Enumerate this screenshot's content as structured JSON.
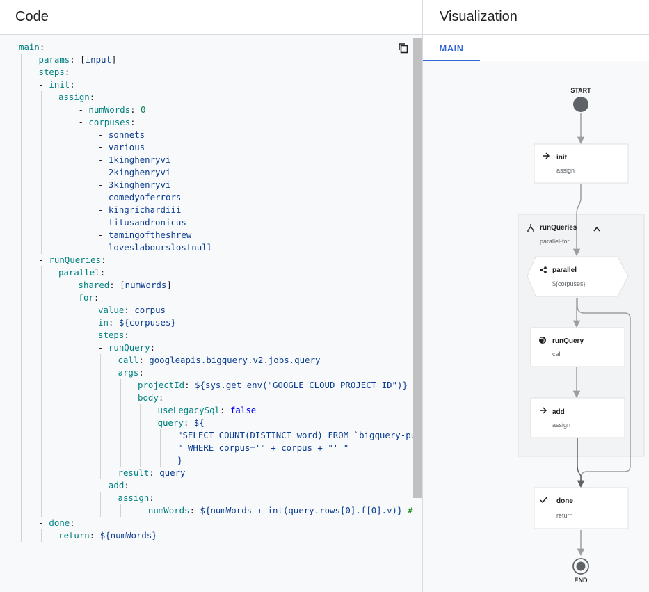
{
  "code_panel": {
    "title": "Code",
    "copy_icon": "copy-icon",
    "lines": [
      {
        "indent": 0,
        "tokens": [
          [
            "key",
            "main"
          ],
          [
            "punc",
            ":"
          ]
        ]
      },
      {
        "indent": 1,
        "tokens": [
          [
            "key",
            "params"
          ],
          [
            "punc",
            ": ["
          ],
          [
            "val",
            "input"
          ],
          [
            "punc",
            "]"
          ]
        ]
      },
      {
        "indent": 1,
        "tokens": [
          [
            "key",
            "steps"
          ],
          [
            "punc",
            ":"
          ]
        ]
      },
      {
        "indent": 1,
        "tokens": [
          [
            "dash",
            "- "
          ],
          [
            "key",
            "init"
          ],
          [
            "punc",
            ":"
          ]
        ]
      },
      {
        "indent": 2,
        "tokens": [
          [
            "key",
            "assign"
          ],
          [
            "punc",
            ":"
          ]
        ]
      },
      {
        "indent": 3,
        "tokens": [
          [
            "dash",
            "- "
          ],
          [
            "key",
            "numWords"
          ],
          [
            "punc",
            ": "
          ],
          [
            "num",
            "0"
          ]
        ]
      },
      {
        "indent": 3,
        "tokens": [
          [
            "dash",
            "- "
          ],
          [
            "key",
            "corpuses"
          ],
          [
            "punc",
            ":"
          ]
        ]
      },
      {
        "indent": 4,
        "tokens": [
          [
            "dash",
            "- "
          ],
          [
            "val",
            "sonnets"
          ]
        ]
      },
      {
        "indent": 4,
        "tokens": [
          [
            "dash",
            "- "
          ],
          [
            "val",
            "various"
          ]
        ]
      },
      {
        "indent": 4,
        "tokens": [
          [
            "dash",
            "- "
          ],
          [
            "val",
            "1kinghenryvi"
          ]
        ]
      },
      {
        "indent": 4,
        "tokens": [
          [
            "dash",
            "- "
          ],
          [
            "val",
            "2kinghenryvi"
          ]
        ]
      },
      {
        "indent": 4,
        "tokens": [
          [
            "dash",
            "- "
          ],
          [
            "val",
            "3kinghenryvi"
          ]
        ]
      },
      {
        "indent": 4,
        "tokens": [
          [
            "dash",
            "- "
          ],
          [
            "val",
            "comedyoferrors"
          ]
        ]
      },
      {
        "indent": 4,
        "tokens": [
          [
            "dash",
            "- "
          ],
          [
            "val",
            "kingrichardiii"
          ]
        ]
      },
      {
        "indent": 4,
        "tokens": [
          [
            "dash",
            "- "
          ],
          [
            "val",
            "titusandronicus"
          ]
        ]
      },
      {
        "indent": 4,
        "tokens": [
          [
            "dash",
            "- "
          ],
          [
            "val",
            "tamingoftheshrew"
          ]
        ]
      },
      {
        "indent": 4,
        "tokens": [
          [
            "dash",
            "- "
          ],
          [
            "val",
            "loveslabourslostnull"
          ]
        ]
      },
      {
        "indent": 1,
        "tokens": [
          [
            "dash",
            "- "
          ],
          [
            "key",
            "runQueries"
          ],
          [
            "punc",
            ":"
          ]
        ]
      },
      {
        "indent": 2,
        "tokens": [
          [
            "key",
            "parallel"
          ],
          [
            "punc",
            ":"
          ]
        ]
      },
      {
        "indent": 3,
        "tokens": [
          [
            "key",
            "shared"
          ],
          [
            "punc",
            ": ["
          ],
          [
            "val",
            "numWords"
          ],
          [
            "punc",
            "]"
          ]
        ]
      },
      {
        "indent": 3,
        "tokens": [
          [
            "key",
            "for"
          ],
          [
            "punc",
            ":"
          ]
        ]
      },
      {
        "indent": 4,
        "tokens": [
          [
            "key",
            "value"
          ],
          [
            "punc",
            ": "
          ],
          [
            "val",
            "corpus"
          ]
        ]
      },
      {
        "indent": 4,
        "tokens": [
          [
            "key",
            "in"
          ],
          [
            "punc",
            ": "
          ],
          [
            "val",
            "${corpuses}"
          ]
        ]
      },
      {
        "indent": 4,
        "tokens": [
          [
            "key",
            "steps"
          ],
          [
            "punc",
            ":"
          ]
        ]
      },
      {
        "indent": 4,
        "tokens": [
          [
            "dash",
            "- "
          ],
          [
            "key",
            "runQuery"
          ],
          [
            "punc",
            ":"
          ]
        ]
      },
      {
        "indent": 5,
        "tokens": [
          [
            "key",
            "call"
          ],
          [
            "punc",
            ": "
          ],
          [
            "val",
            "googleapis.bigquery.v2.jobs.query"
          ]
        ]
      },
      {
        "indent": 5,
        "tokens": [
          [
            "key",
            "args"
          ],
          [
            "punc",
            ":"
          ]
        ]
      },
      {
        "indent": 6,
        "tokens": [
          [
            "key",
            "projectId"
          ],
          [
            "punc",
            ": "
          ],
          [
            "val",
            "${sys.get_env(\"GOOGLE_CLOUD_PROJECT_ID\")}"
          ]
        ]
      },
      {
        "indent": 6,
        "tokens": [
          [
            "key",
            "body"
          ],
          [
            "punc",
            ":"
          ]
        ]
      },
      {
        "indent": 7,
        "tokens": [
          [
            "key",
            "useLegacySql"
          ],
          [
            "punc",
            ": "
          ],
          [
            "bool",
            "false"
          ]
        ]
      },
      {
        "indent": 7,
        "tokens": [
          [
            "key",
            "query"
          ],
          [
            "punc",
            ": "
          ],
          [
            "val",
            "${"
          ]
        ]
      },
      {
        "indent": 8,
        "tokens": [
          [
            "str",
            "\"SELECT COUNT(DISTINCT word) FROM `bigquery-publi"
          ]
        ]
      },
      {
        "indent": 8,
        "tokens": [
          [
            "str",
            "\" WHERE corpus='\" + corpus + \"' \""
          ]
        ]
      },
      {
        "indent": 8,
        "tokens": [
          [
            "val",
            "}"
          ]
        ]
      },
      {
        "indent": 5,
        "tokens": [
          [
            "key",
            "result"
          ],
          [
            "punc",
            ": "
          ],
          [
            "val",
            "query"
          ]
        ]
      },
      {
        "indent": 4,
        "tokens": [
          [
            "dash",
            "- "
          ],
          [
            "key",
            "add"
          ],
          [
            "punc",
            ":"
          ]
        ]
      },
      {
        "indent": 5,
        "tokens": [
          [
            "key",
            "assign"
          ],
          [
            "punc",
            ":"
          ]
        ]
      },
      {
        "indent": 6,
        "tokens": [
          [
            "dash",
            "- "
          ],
          [
            "key",
            "numWords"
          ],
          [
            "punc",
            ": "
          ],
          [
            "val",
            "${numWords + int(query.rows[0].f[0].v)} "
          ],
          [
            "com",
            "# fir"
          ]
        ]
      },
      {
        "indent": 1,
        "tokens": [
          [
            "dash",
            "- "
          ],
          [
            "key",
            "done"
          ],
          [
            "punc",
            ":"
          ]
        ]
      },
      {
        "indent": 2,
        "tokens": [
          [
            "key",
            "return"
          ],
          [
            "punc",
            ": "
          ],
          [
            "val",
            "${numWords}"
          ]
        ]
      }
    ]
  },
  "visualization_panel": {
    "title": "Visualization",
    "tabs": [
      {
        "label": "MAIN",
        "active": true
      }
    ],
    "start_label": "START",
    "end_label": "END",
    "nodes": {
      "init": {
        "label": "init",
        "sub": "assign",
        "icon": "arrow-right-icon"
      },
      "runQueries": {
        "label": "runQueries",
        "sub": "parallel-for",
        "icon": "parallel-for-icon"
      },
      "parallel": {
        "label": "parallel",
        "sub": "${corpuses}",
        "icon": "share-icon"
      },
      "runQuery": {
        "label": "runQuery",
        "sub": "call",
        "icon": "globe-icon"
      },
      "add": {
        "label": "add",
        "sub": "assign",
        "icon": "arrow-right-icon"
      },
      "done": {
        "label": "done",
        "sub": "return",
        "icon": "check-icon"
      }
    },
    "collapse_icon": "chevron-up-icon"
  }
}
